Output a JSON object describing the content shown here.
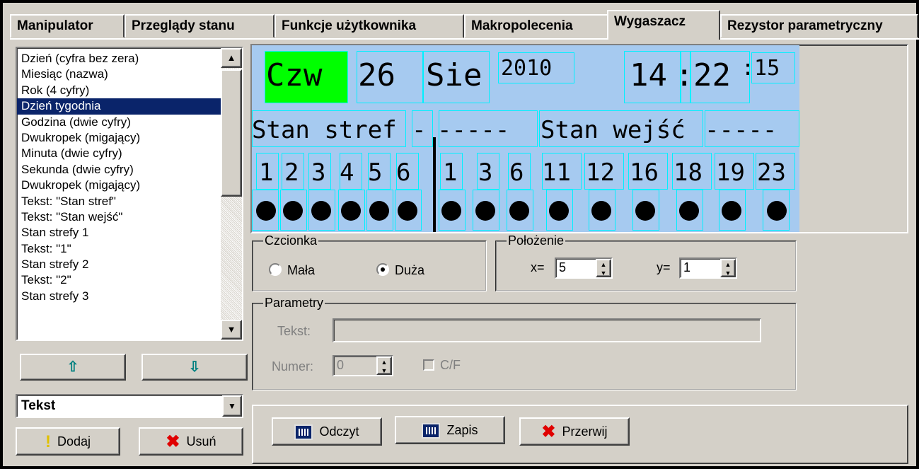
{
  "tabs": [
    "Manipulator",
    "Przeglądy stanu",
    "Funkcje użytkownika",
    "Makropolecenia",
    "Wygaszacz",
    "Rezystor parametryczny"
  ],
  "active_tab": "Wygaszacz",
  "list": {
    "items": [
      "Dzień (cyfra bez zera)",
      "Miesiąc (nazwa)",
      "Rok (4 cyfry)",
      "Dzień tygodnia",
      "Godzina (dwie cyfry)",
      "Dwukropek (migający)",
      "Minuta (dwie cyfry)",
      "Sekunda (dwie cyfry)",
      "Dwukropek (migający)",
      "Tekst: \"Stan stref\"",
      "Tekst: \"Stan wejść\"",
      "Stan strefy 1",
      "Tekst: \"1\"",
      "Stan strefy 2",
      "Tekst: \"2\"",
      "Stan strefy 3"
    ],
    "selected_index": 3
  },
  "buttons": {
    "up_icon": "arrow-up-icon",
    "down_icon": "arrow-down-icon",
    "add": "Dodaj",
    "remove": "Usuń",
    "read": "Odczyt",
    "save": "Zapis",
    "abort": "Przerwij"
  },
  "combo": {
    "value": "Tekst"
  },
  "lcd": {
    "day_of_week": "Czw",
    "day": "26",
    "month": "Sie",
    "year": "2010",
    "hour": "14",
    "colon": ":",
    "minute": "22",
    "seconds": ":15",
    "row2_left": "Stan stref",
    "row2_dash1": "-",
    "row2_dashes": "-----",
    "row2_right": "Stan wejść",
    "row2_dashes2": "-----",
    "zones": [
      "1",
      "2",
      "3",
      "4",
      "5",
      "6"
    ],
    "inputs": [
      "1",
      "3",
      "6",
      "11",
      "12",
      "16",
      "18",
      "19",
      "23"
    ],
    "highlight_color": "#00ff00",
    "background_color": "#a6caf0",
    "cell_border_color": "#00f0ff"
  },
  "font_group": {
    "title": "Czcionka",
    "small": "Mała",
    "large": "Duża",
    "selected": "Duża"
  },
  "position_group": {
    "title": "Położenie",
    "x_label": "x=",
    "x_value": "5",
    "y_label": "y=",
    "y_value": "1"
  },
  "params_group": {
    "title": "Parametry",
    "text_label": "Tekst:",
    "text_value": "",
    "number_label": "Numer:",
    "number_value": "0",
    "cf_label": "C/F"
  }
}
